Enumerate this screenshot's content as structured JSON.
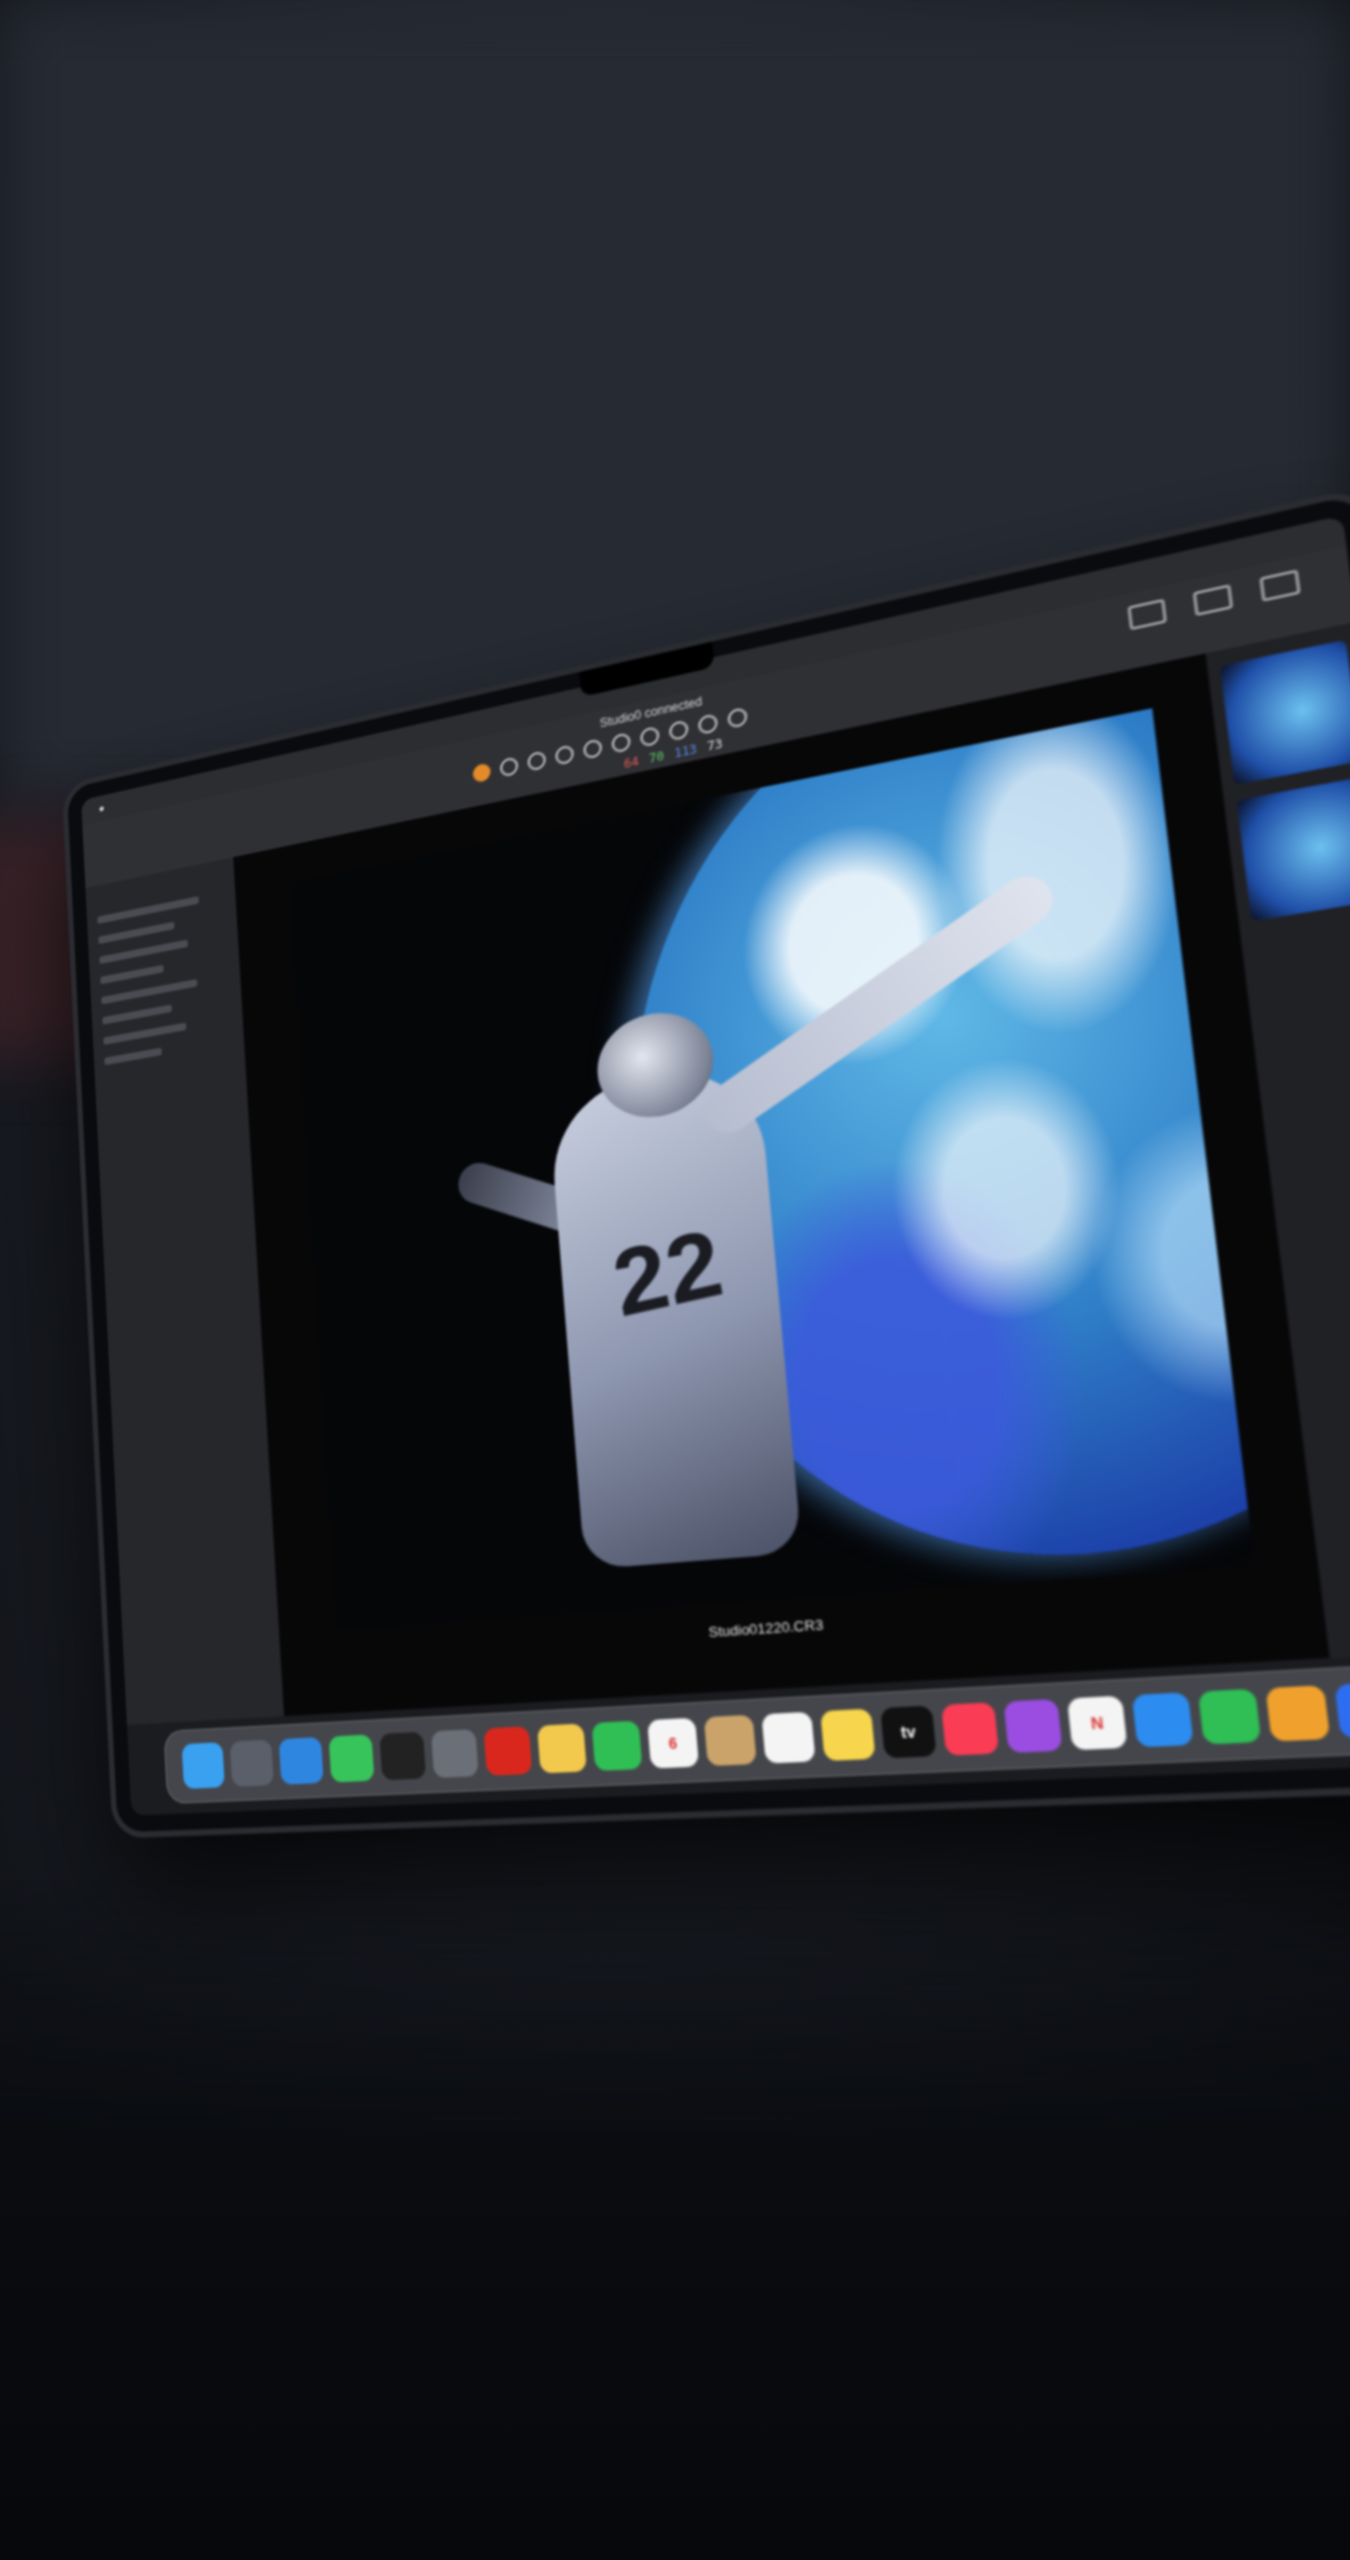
{
  "app": {
    "title": "Studio0 connected",
    "menubar_items": [
      "",
      "",
      "",
      "",
      "",
      "",
      ""
    ]
  },
  "readout": {
    "label_r": "64",
    "label_g": "70",
    "label_b": "113",
    "label_a": "73",
    "colors": {
      "r": "#e25b5b",
      "g": "#5fd26b",
      "b": "#5b8ff0",
      "a": "#e6e6e6"
    }
  },
  "viewer": {
    "filename": "Studio01220.CR3",
    "zoom_info": "",
    "jersey_number": "22"
  },
  "toolbar": {
    "tools": [
      "crop-tool-icon",
      "straighten-icon",
      "spot-removal-icon",
      "brush-icon",
      "eraser-icon",
      "gradient-icon",
      "radial-icon",
      "color-picker-icon",
      "text-icon",
      "zoom-icon"
    ]
  },
  "dock": {
    "apps": [
      {
        "name": "finder",
        "color": "#3aa0f0",
        "glyph": ""
      },
      {
        "name": "launchpad",
        "color": "#5a5f6a",
        "glyph": ""
      },
      {
        "name": "safari",
        "color": "#2f86e0",
        "glyph": ""
      },
      {
        "name": "messages",
        "color": "#37c45a",
        "glyph": ""
      },
      {
        "name": "terminal",
        "color": "#222",
        "glyph": ""
      },
      {
        "name": "settings",
        "color": "#6b6f77",
        "glyph": ""
      },
      {
        "name": "acrobat",
        "color": "#d9271d",
        "glyph": ""
      },
      {
        "name": "photos",
        "color": "#f2c94c",
        "glyph": ""
      },
      {
        "name": "facetime",
        "color": "#2fbf55",
        "glyph": ""
      },
      {
        "name": "calendar",
        "color": "#f4f4f4",
        "glyph": "6"
      },
      {
        "name": "contacts",
        "color": "#c9a36a",
        "glyph": ""
      },
      {
        "name": "reminders",
        "color": "#f4f4f4",
        "glyph": ""
      },
      {
        "name": "notes",
        "color": "#f7d54c",
        "glyph": ""
      },
      {
        "name": "tv",
        "color": "#111",
        "glyph": "tv"
      },
      {
        "name": "music",
        "color": "#fb3c55",
        "glyph": ""
      },
      {
        "name": "podcasts",
        "color": "#9a4de0",
        "glyph": ""
      },
      {
        "name": "news",
        "color": "#f4f4f4",
        "glyph": "N"
      },
      {
        "name": "app-store",
        "color": "#2d8cf0",
        "glyph": ""
      },
      {
        "name": "numbers",
        "color": "#2fbf55",
        "glyph": ""
      },
      {
        "name": "pages",
        "color": "#f0a12d",
        "glyph": ""
      },
      {
        "name": "keynote",
        "color": "#2d6ef0",
        "glyph": ""
      },
      {
        "name": "system-preferences",
        "color": "#8a8e96",
        "glyph": ""
      },
      {
        "name": "lightroom",
        "color": "#1e3a5a",
        "glyph": ""
      },
      {
        "name": "trash",
        "color": "#c9ccd2",
        "glyph": ""
      }
    ]
  }
}
